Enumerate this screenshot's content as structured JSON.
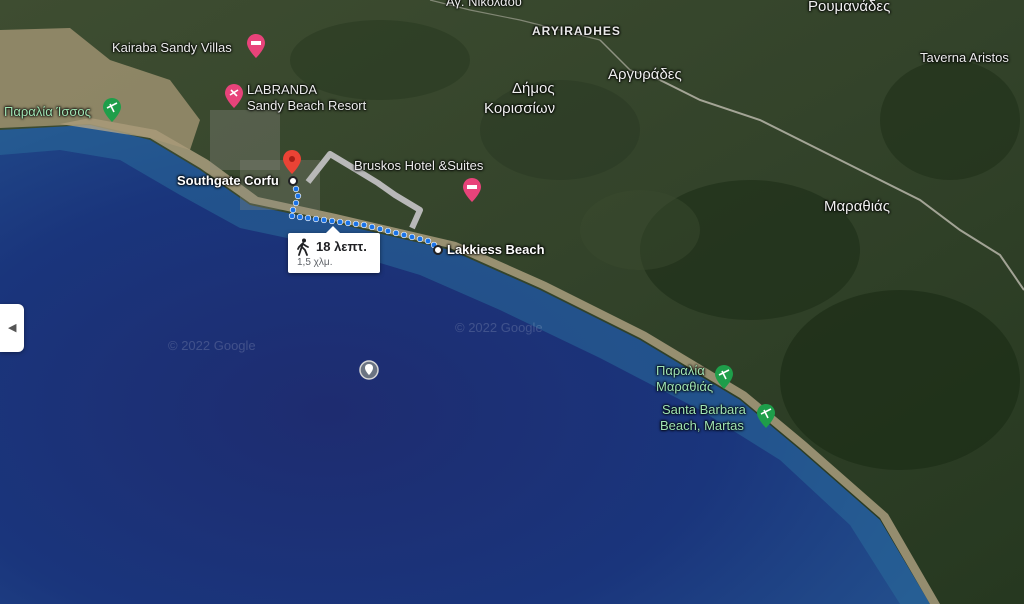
{
  "map": {
    "places": {
      "ai_nikolaou": "Αγ. Νικολάου",
      "aryiradhes_latin": "ARYIRADHES",
      "roumanades": "Ρουμανάδες",
      "taverna": "Taverna Aristos",
      "argyrades": "Αργυράδες",
      "dimos_line1": "Δήμος",
      "dimos_line2": "Κορισσίων",
      "marathias": "Μαραθιάς"
    },
    "pois": {
      "kairaba": "Kairaba Sandy Villas",
      "labranda_line1": "LABRANDA",
      "labranda_line2": "Sandy Beach Resort",
      "issos": "Παραλία Ίσσος",
      "bruskos": "Bruskos Hotel &Suites",
      "southgate": "Southgate Corfu",
      "lakkiess": "Lakkiess Beach",
      "paralia_marathias_line1": "Παραλία",
      "paralia_marathias_line2": "Μαραθιάς",
      "santa_barbara_line1": "Santa Barbara",
      "santa_barbara_line2": "Beach, Martas"
    },
    "route": {
      "mode_icon": "walking-icon",
      "duration": "18 λεπτ.",
      "distance": "1,5 χλμ."
    },
    "watermarks": [
      "© 2022 Google",
      "© 2022 Google"
    ],
    "collapse_icon": "chevron-left-icon",
    "colors": {
      "route": "#1a73e8",
      "alt_route": "#b8b8b8",
      "pin": "#ea4335",
      "hotel_pin": "#e8437a",
      "beach_pin": "#1e9e4a"
    }
  }
}
